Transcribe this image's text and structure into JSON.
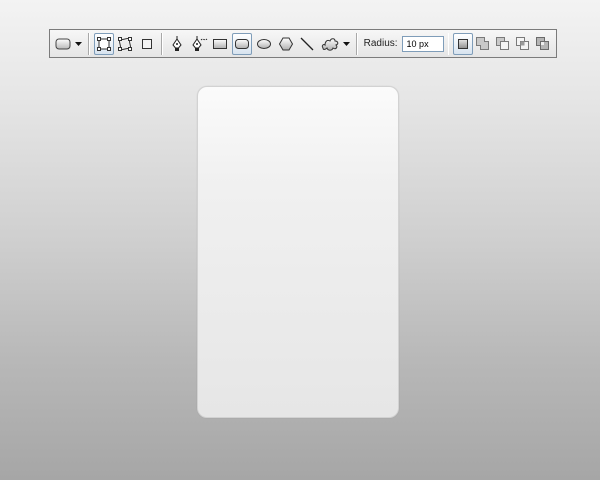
{
  "toolbar": {
    "tool_preset_icon": "rounded-rect-preset-icon",
    "mode_buttons": [
      {
        "name": "shape-layers-icon",
        "active": true
      },
      {
        "name": "paths-icon",
        "active": false
      },
      {
        "name": "fill-pixels-icon",
        "active": false
      }
    ],
    "tool_buttons": [
      {
        "name": "pen-tool-icon",
        "active": false
      },
      {
        "name": "freeform-pen-tool-icon",
        "active": false
      },
      {
        "name": "rectangle-tool-icon",
        "active": false
      },
      {
        "name": "rounded-rectangle-tool-icon",
        "active": true
      },
      {
        "name": "ellipse-tool-icon",
        "active": false
      },
      {
        "name": "polygon-tool-icon",
        "active": false
      },
      {
        "name": "line-tool-icon",
        "active": false
      },
      {
        "name": "custom-shape-tool-icon",
        "active": false
      }
    ],
    "radius_label": "Radius:",
    "radius_value": "10 px",
    "combine_buttons": [
      {
        "name": "create-new-shape-layer-icon",
        "active": true
      },
      {
        "name": "add-to-shape-area-icon",
        "active": false
      },
      {
        "name": "subtract-from-shape-area-icon",
        "active": false
      },
      {
        "name": "intersect-shape-areas-icon",
        "active": false
      },
      {
        "name": "exclude-overlapping-shape-areas-icon",
        "active": false
      }
    ]
  },
  "colors": {
    "accent_border": "#7f9db9",
    "toolbar_border": "#7b7b7b",
    "card_border": "#d2d2d2"
  }
}
